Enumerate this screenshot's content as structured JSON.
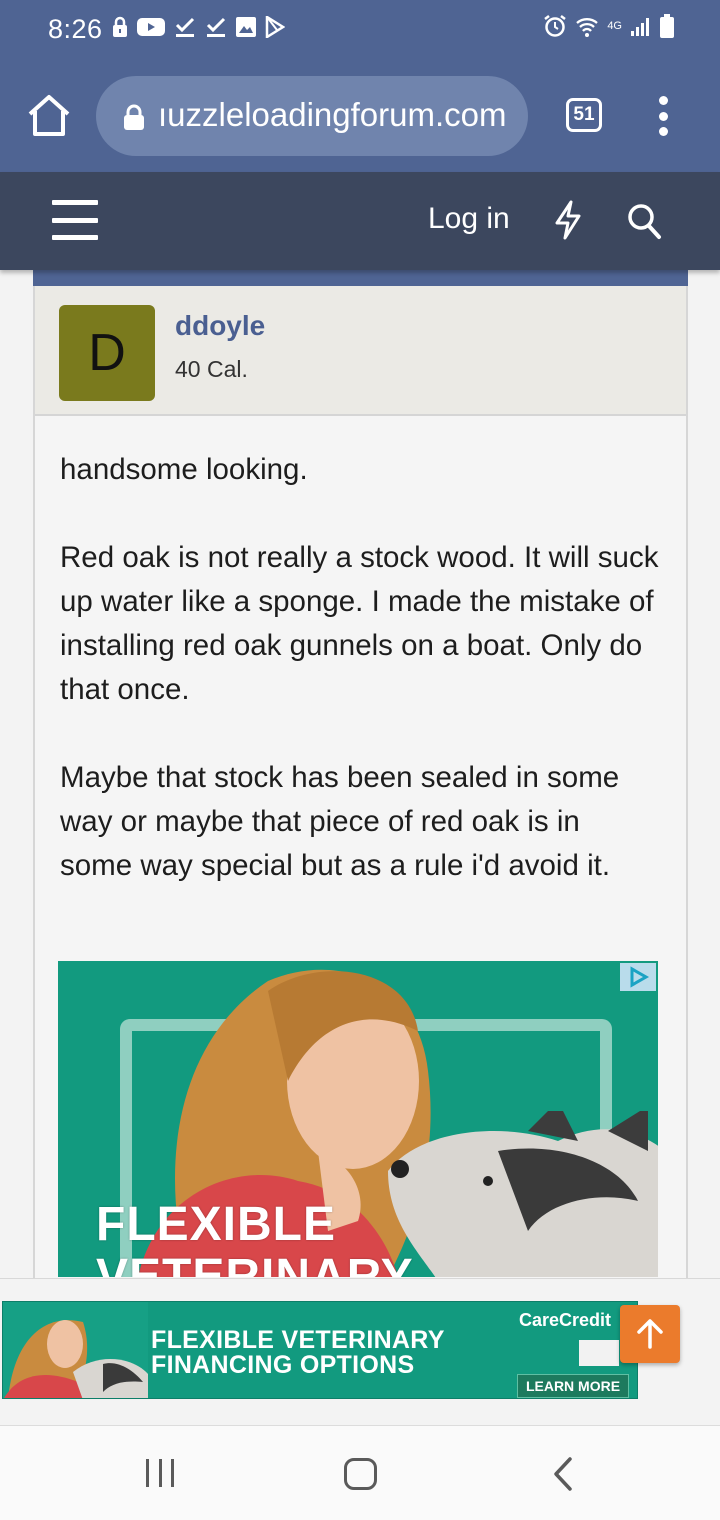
{
  "status_bar": {
    "time": "8:26",
    "network": "4G"
  },
  "browser": {
    "url": "ıuzzleloadingforum.com",
    "tab_count": "51"
  },
  "site_nav": {
    "login_label": "Log in"
  },
  "post": {
    "avatar_letter": "D",
    "username": "ddoyle",
    "user_title": "40 Cal.",
    "paragraphs": [
      "handsome looking.",
      "Red oak is not really a stock wood. It will suck up water like a sponge. I made the mistake of installing red oak gunnels on a boat. Only do that once.",
      "Maybe that stock has been sealed in some way or maybe that piece of red oak is in some way special but as a rule i'd avoid it."
    ]
  },
  "ad_inline": {
    "line1": "FLEXIBLE",
    "line2": "VETERINARY"
  },
  "ad_banner": {
    "line1": "FLEXIBLE VETERINARY",
    "line2": "FINANCING OPTIONS",
    "brand": "CareCredit",
    "cta": "LEARN MORE"
  },
  "colors": {
    "header_blue": "#4f6493",
    "site_nav": "#3c475e",
    "ad_green": "#129a7f",
    "scroll_top_orange": "#eb7b2c",
    "avatar_olive": "#7a7a1d"
  }
}
